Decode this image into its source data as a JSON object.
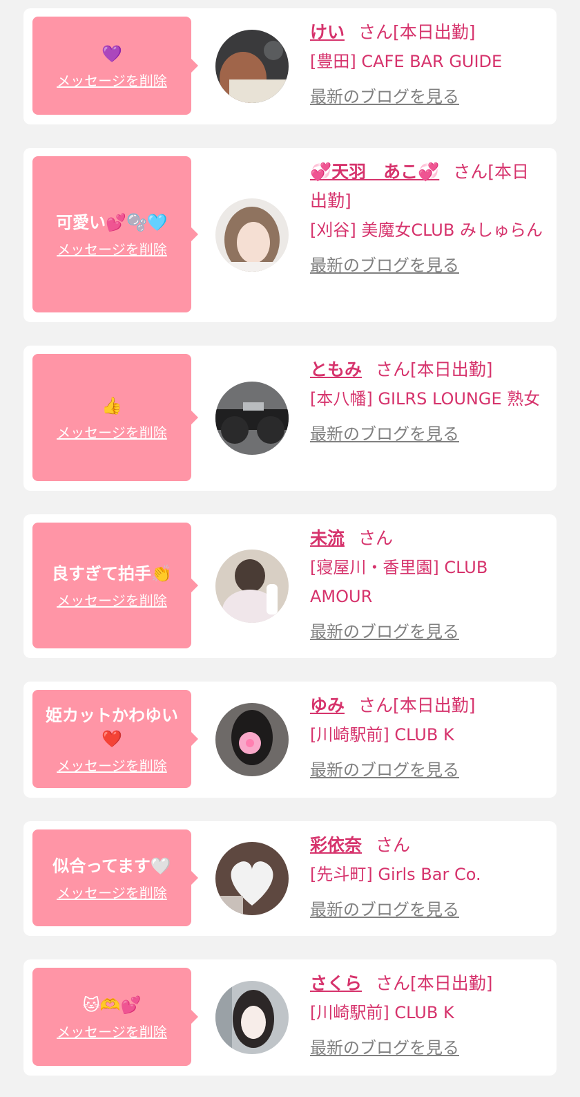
{
  "cards": [
    {
      "message": "💜",
      "delete_label": "メッセージを削除",
      "name": "けい",
      "suffix": "さん[本日出勤]",
      "shop": "[豊田] CAFE BAR GUIDE",
      "blog_label": "最新のブログを見る"
    },
    {
      "message": "可愛い💕🫧🩵",
      "delete_label": "メッセージを削除",
      "name": "💞天羽　あこ💞",
      "suffix": "さん[本日出勤]",
      "shop": "[刈谷] 美魔女CLUB みしゅらん",
      "blog_label": "最新のブログを見る"
    },
    {
      "message": "👍",
      "delete_label": "メッセージを削除",
      "name": "ともみ",
      "suffix": "さん[本日出勤]",
      "shop": "[本八幡] GILRS LOUNGE 熟女",
      "blog_label": "最新のブログを見る"
    },
    {
      "message": "良すぎて拍手👏",
      "delete_label": "メッセージを削除",
      "name": "未流",
      "suffix": "さん",
      "shop": "[寝屋川・香里園] CLUB AMOUR",
      "blog_label": "最新のブログを見る"
    },
    {
      "message": "姫カットかわゆい❤️",
      "delete_label": "メッセージを削除",
      "name": "ゆみ",
      "suffix": "さん[本日出勤]",
      "shop": "[川崎駅前] CLUB K",
      "blog_label": "最新のブログを見る"
    },
    {
      "message": "似合ってます🤍",
      "delete_label": "メッセージを削除",
      "name": "彩依奈",
      "suffix": "さん",
      "shop": "[先斗町] Girls Bar Co.",
      "blog_label": "最新のブログを見る"
    },
    {
      "message": "🐱🫶💕",
      "delete_label": "メッセージを削除",
      "name": "さくら",
      "suffix": "さん[本日出勤]",
      "shop": "[川崎駅前] CLUB K",
      "blog_label": "最新のブログを見る"
    }
  ],
  "colors": {
    "bubble": "#ff95a6",
    "accent": "#d6336c",
    "muted": "#808080",
    "background": "#f2f2f2"
  }
}
